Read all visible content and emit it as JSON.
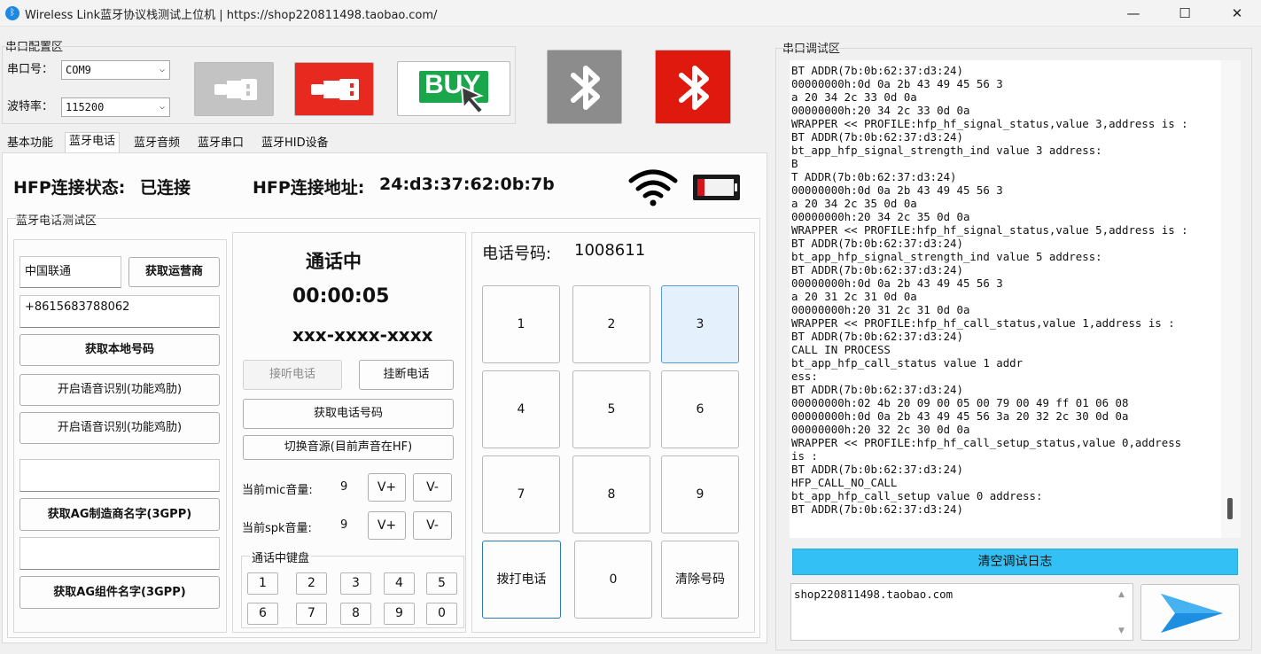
{
  "window": {
    "title": "Wireless Link蓝牙协议栈测试上位机 | https://shop220811498.taobao.com/",
    "minimize": "—",
    "maximize": "☐",
    "close": "✕"
  },
  "serial_config": {
    "group_label": "串口配置区",
    "port_label": "串口号：",
    "port_value": "COM9",
    "baud_label": "波特率：",
    "baud_value": "115200",
    "buy_label": "BUY"
  },
  "tabs": [
    "基本功能",
    "蓝牙电话",
    "蓝牙音频",
    "蓝牙串口",
    "蓝牙HID设备"
  ],
  "hfp": {
    "status_label": "HFP连接状态:",
    "status_value": "已连接",
    "addr_label": "HFP连接地址:",
    "addr_value": "24:d3:37:62:0b:7b",
    "battery_level": 0.2
  },
  "phone_test": {
    "group_label": "蓝牙电话测试区",
    "operator_value": "中国联通",
    "get_operator": "获取运营商",
    "local_number_value": "+8615683788062",
    "get_local_number": "获取本地号码",
    "voice_rec_1": "开启语音识别(功能鸡肋)",
    "voice_rec_2": "开启语音识别(功能鸡肋)",
    "ag_manufacturer_value": "",
    "get_ag_manufacturer": "获取AG制造商名字(3GPP)",
    "ag_model_value": "",
    "get_ag_model": "获取AG组件名字(3GPP)"
  },
  "call": {
    "state": "通话中",
    "timer": "00:00:05",
    "number": "xxx-xxxx-xxxx",
    "answer": "接听电话",
    "hangup": "挂断电话",
    "get_number": "获取电话号码",
    "switch_audio": "切换音源(目前声音在HF)",
    "mic_label": "当前mic音量:",
    "mic_value": "9",
    "spk_label": "当前spk音量:",
    "spk_value": "9",
    "vol_up": "V+",
    "vol_down": "V-",
    "in_call_keypad_label": "通话中键盘",
    "in_call_keys": [
      "1",
      "2",
      "3",
      "4",
      "5",
      "6",
      "7",
      "8",
      "9",
      "0"
    ]
  },
  "dialer": {
    "number_label": "电话号码:",
    "number_value": "1008611",
    "keys": [
      "1",
      "2",
      "3",
      "4",
      "5",
      "6",
      "7",
      "8",
      "9"
    ],
    "dial": "拨打电话",
    "zero": "0",
    "clear": "清除号码"
  },
  "debug": {
    "group_label": "串口调试区",
    "log": "BT ADDR(7b:0b:62:37:d3:24)\n00000000h:0d 0a 2b 43 49 45 56 3\na 20 34 2c 33 0d 0a\n00000000h:20 34 2c 33 0d 0a\nWRAPPER << PROFILE:hfp_hf_signal_status,value 3,address is :\nBT ADDR(7b:0b:62:37:d3:24)\nbt_app_hfp_signal_strength_ind value 3 address:\nB\nT ADDR(7b:0b:62:37:d3:24)\n00000000h:0d 0a 2b 43 49 45 56 3\na 20 34 2c 35 0d 0a\n00000000h:20 34 2c 35 0d 0a\nWRAPPER << PROFILE:hfp_hf_signal_status,value 5,address is :\nBT ADDR(7b:0b:62:37:d3:24)\nbt_app_hfp_signal_strength_ind value 5 address:\nBT ADDR(7b:0b:62:37:d3:24)\n00000000h:0d 0a 2b 43 49 45 56 3\na 20 31 2c 31 0d 0a\n00000000h:20 31 2c 31 0d 0a\nWRAPPER << PROFILE:hfp_hf_call_status,value 1,address is :\nBT ADDR(7b:0b:62:37:d3:24)\nCALL IN PROCESS\nbt_app_hfp_call_status value 1 addr\ness:\nBT ADDR(7b:0b:62:37:d3:24)\n00000000h:02 4b 20 09 00 05 00 79 00 49 ff 01 06 08\n00000000h:0d 0a 2b 43 49 45 56 3a 20 32 2c 30 0d 0a\n00000000h:20 32 2c 30 0d 0a\nWRAPPER << PROFILE:hfp_hf_call_setup_status,value 0,address\nis :\nBT ADDR(7b:0b:62:37:d3:24)\nHFP_CALL_NO_CALL\nbt_app_hfp_call_setup value 0 address:\nBT ADDR(7b:0b:62:37:d3:24)",
    "clear_log": "清空调试日志",
    "send_value": "shop220811498.taobao.com"
  },
  "colors": {
    "accent_blue": "#33c0f5",
    "red_button": "#e8291f",
    "gray_button": "#8c8c8c",
    "buy_green": "#1aa64a"
  }
}
